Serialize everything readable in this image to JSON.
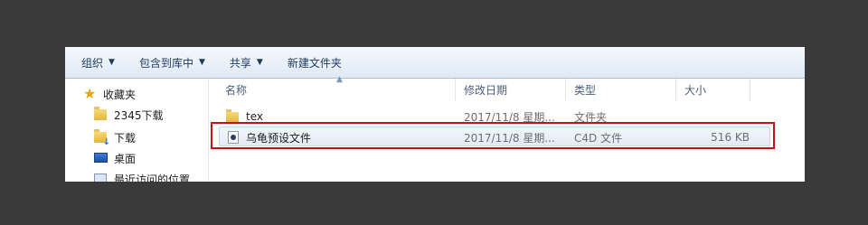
{
  "toolbar": {
    "organize": "组织",
    "include_in_library": "包含到库中",
    "share": "共享",
    "new_folder": "新建文件夹"
  },
  "nav": {
    "favorites": "收藏夹",
    "items": [
      {
        "label": "2345下载",
        "icon": "folder-icon"
      },
      {
        "label": "下载",
        "icon": "downloads-folder-icon"
      },
      {
        "label": "桌面",
        "icon": "desktop-icon"
      },
      {
        "label": "最近访问的位置",
        "icon": "recent-places-icon"
      }
    ]
  },
  "columns": {
    "name": "名称",
    "date": "修改日期",
    "type": "类型",
    "size": "大小"
  },
  "files": [
    {
      "name": "tex",
      "date": "2017/11/8 星期...",
      "type": "文件夹",
      "size": "",
      "icon": "folder-icon"
    },
    {
      "name": "乌龟预设文件",
      "date": "2017/11/8 星期...",
      "type": "C4D 文件",
      "size": "516 KB",
      "icon": "c4d-file-icon"
    }
  ],
  "colors": {
    "highlight": "#c4121b",
    "background": "#3a3a3a"
  }
}
